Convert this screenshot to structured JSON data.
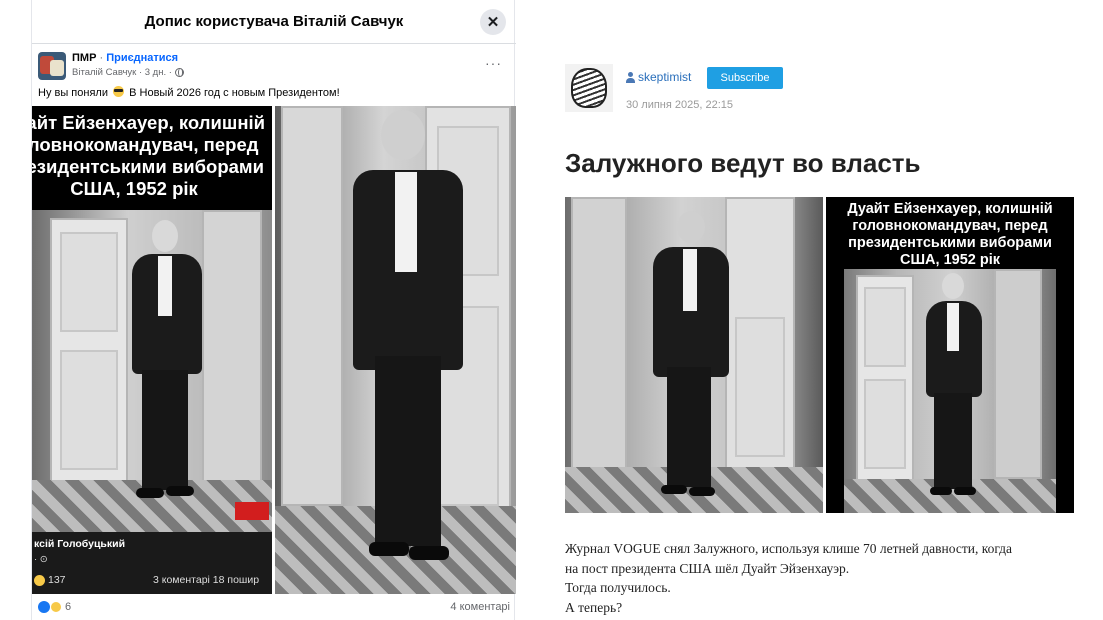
{
  "facebook_post": {
    "dialog_title": "Допис користувача Віталій Савчук",
    "close_icon": "close-icon",
    "group_name": "ПМР",
    "separator": "·",
    "join_label": "Приєднатися",
    "author_line": "Віталій Савчук · 3 дн. ·",
    "privacy_icon": "globe-icon",
    "more_icon": "more-options-icon",
    "more_label": "···",
    "text_before_emoji": "Ну вы поняли",
    "text_after_emoji": "В Новый 2026 год с новым Президентом!",
    "emoji": "sunglasses-emoji",
    "photo": {
      "caption_lines": [
        "Дуайт Ейзенхауер, колишній",
        "головнокомандувач, перед",
        "президентськими виборами",
        "США, 1952 рік"
      ],
      "channel_name": "ксій Голобуцький",
      "channel_sub": "· ⊙",
      "inner_reactions_count": "137",
      "inner_comments": "3 коментарі  18 пошир"
    },
    "reactions_count": "6",
    "comments_label": "4 коментарі"
  },
  "blog_post": {
    "username": "skeptimist",
    "subscribe_label": "Subscribe",
    "date": "30 липня 2025, 22:15",
    "title": "Залужного ведут во власть",
    "photo_caption_lines": [
      "Дуайт Ейзенхауер, колишній",
      "головнокомандувач, перед",
      "президентськими виборами",
      "США, 1952 рік"
    ],
    "body_lines": [
      "Журнал VOGUE снял Залужного, используя клише 70 летней давности, когда",
      "на пост президента США шёл Дуайт Эйзенхауэр.",
      "Тогда получилось.",
      "А теперь?"
    ]
  },
  "colors": {
    "facebook_blue": "#0866ff",
    "subscribe_blue": "#1f9fe3",
    "link_blue": "#2a6fbb"
  }
}
